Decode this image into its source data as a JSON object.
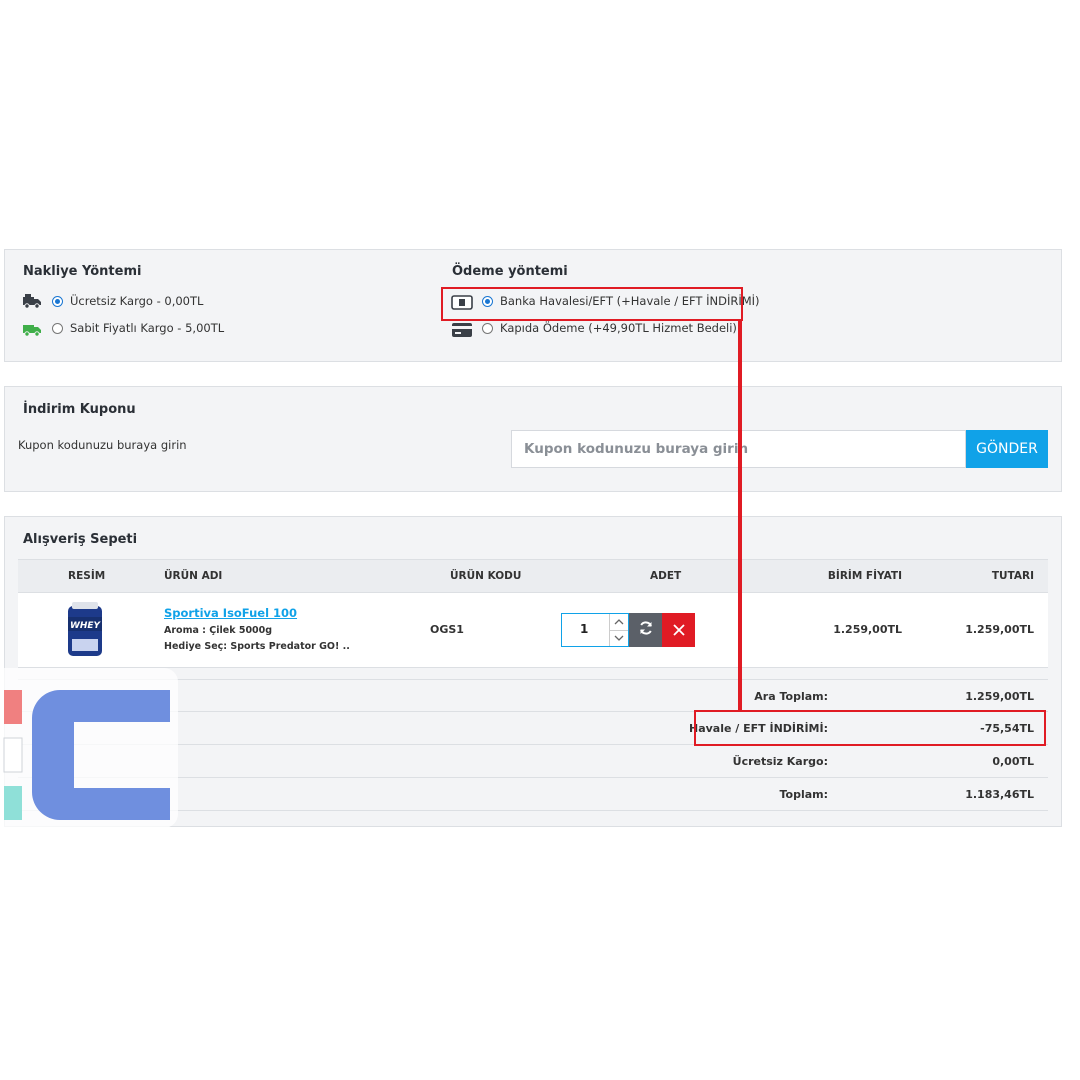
{
  "shipping": {
    "title": "Nakliye Yöntemi",
    "options": [
      {
        "label": "Ücretsiz Kargo - 0,00TL",
        "selected": true,
        "icon": "truck-icon"
      },
      {
        "label": "Sabit Fiyatlı Kargo - 5,00TL",
        "selected": false,
        "icon": "green-truck-icon"
      }
    ]
  },
  "payment": {
    "title": "Ödeme yöntemi",
    "options": [
      {
        "label": "Banka Havalesi/EFT (+Havale / EFT İNDİRİMİ)",
        "selected": true,
        "icon": "banknote-icon"
      },
      {
        "label": "Kapıda Ödeme (+49,90TL Hizmet Bedeli)",
        "selected": false,
        "icon": "credit-card-icon"
      }
    ]
  },
  "coupon": {
    "title": "İndirim Kuponu",
    "helper": "Kupon kodunuzu buraya girin",
    "placeholder": "Kupon kodunuzu buraya girin",
    "button": "GÖNDER"
  },
  "cart": {
    "title": "Alışveriş Sepeti",
    "columns": [
      "RESİM",
      "ÜRÜN ADI",
      "ÜRÜN KODU",
      "ADET",
      "BİRİM FİYATI",
      "TUTARI"
    ],
    "item": {
      "image_text": "WHEY",
      "name": "Sportiva IsoFuel 100",
      "option1": "Aroma : Çilek 5000g",
      "option2": "Hediye Seç: Sports Predator GO! ..",
      "code": "OGS1",
      "quantity": "1",
      "unit_price": "1.259,00TL",
      "total": "1.259,00TL"
    },
    "totals": [
      {
        "label": "Ara Toplam:",
        "value": "1.259,00TL"
      },
      {
        "label": "Havale / EFT İNDİRİMİ:",
        "value": "-75,54TL"
      },
      {
        "label": "Ücretsiz Kargo:",
        "value": "0,00TL"
      },
      {
        "label": "Toplam:",
        "value": "1.183,46TL"
      }
    ]
  },
  "colors": {
    "accent": "#10a2e8",
    "highlight": "#e01b24",
    "radio": "#1976d2",
    "watermark_blue": "#6f8fdf"
  }
}
